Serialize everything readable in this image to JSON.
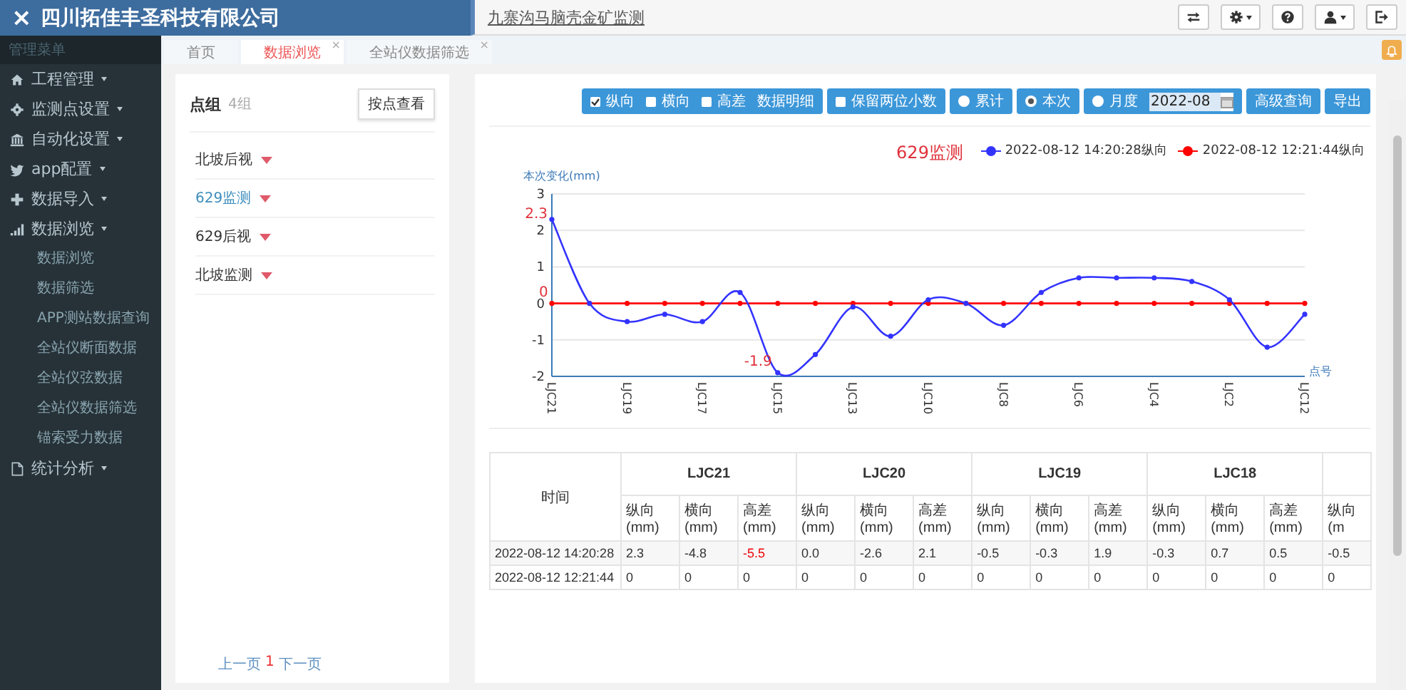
{
  "brand": {
    "close": "×",
    "title": "四川拓佳丰圣科技有限公司"
  },
  "header": {
    "title": "九寨沟马脑壳金矿监测"
  },
  "sidebar": {
    "heading": "管理菜单",
    "items": [
      {
        "label": "工程管理"
      },
      {
        "label": "监测点设置"
      },
      {
        "label": "自动化设置"
      },
      {
        "label": "app配置"
      },
      {
        "label": "数据导入"
      },
      {
        "label": "数据浏览",
        "children": [
          {
            "label": "数据浏览"
          },
          {
            "label": "数据筛选"
          },
          {
            "label": "APP测站数据查询"
          },
          {
            "label": "全站仪断面数据"
          },
          {
            "label": "全站仪弦数据"
          },
          {
            "label": "全站仪数据筛选"
          },
          {
            "label": "锚索受力数据"
          }
        ]
      },
      {
        "label": "统计分析"
      }
    ]
  },
  "tabs": [
    {
      "label": "首页",
      "selected": false
    },
    {
      "label": "数据浏览",
      "close": "×",
      "selected": true
    },
    {
      "label": "全站仪数据筛选",
      "close": "×",
      "selected": false
    }
  ],
  "groups_panel": {
    "title": "点组",
    "count": "4组",
    "button": "按点查看",
    "groups": [
      {
        "label": "北坡后视",
        "selected": false
      },
      {
        "label": "629监测",
        "selected": true
      },
      {
        "label": "629后视",
        "selected": false
      },
      {
        "label": "北坡监测",
        "selected": false
      }
    ],
    "pagination": [
      {
        "label": "上一页",
        "current": false
      },
      {
        "label": "1",
        "current": true
      },
      {
        "label": "下一页",
        "current": false
      }
    ]
  },
  "toolbar": [
    {
      "kind": "group",
      "items": [
        {
          "kind": "checkbox",
          "label": "纵向",
          "checked": true
        },
        {
          "kind": "checkbox",
          "label": "横向",
          "checked": false
        },
        {
          "kind": "checkbox",
          "label": "高差",
          "checked": false
        },
        {
          "kind": "text",
          "label": "数据明细"
        }
      ]
    },
    {
      "kind": "group",
      "items": [
        {
          "kind": "checkbox",
          "label": "保留两位小数",
          "checked": false
        }
      ]
    },
    {
      "kind": "group",
      "items": [
        {
          "kind": "radio",
          "label": "累计",
          "selected": false
        }
      ]
    },
    {
      "kind": "group",
      "items": [
        {
          "kind": "radio",
          "label": "本次",
          "selected": true
        }
      ]
    },
    {
      "kind": "group",
      "items": [
        {
          "kind": "radio",
          "label": "月度",
          "selected": false
        },
        {
          "kind": "date",
          "value": "2022-08"
        }
      ]
    },
    {
      "kind": "button",
      "label": "高级查询"
    },
    {
      "kind": "button",
      "label": "导出"
    }
  ],
  "chart": {
    "chart_data": {
      "type": "line",
      "title": "629监测",
      "xlabel": "点号",
      "ylabel": "本次变化(mm)",
      "categories": [
        "LJC21",
        null,
        "LJC19",
        null,
        "LJC17",
        null,
        "LJC15",
        null,
        "LJC13",
        null,
        "LJC10",
        null,
        "LJC8",
        null,
        "LJC6",
        null,
        "LJC4",
        null,
        "LJC2",
        null,
        "LJC12"
      ],
      "ylim": [
        -2,
        3
      ],
      "yticks": [
        -2,
        -1,
        0,
        1,
        2,
        3
      ],
      "grid": true,
      "legend": true,
      "series": [
        {
          "name": "2022-08-12 14:20:28纵向",
          "color": "#3333ff",
          "marker": "circle",
          "values": [
            2.3,
            0.0,
            -0.5,
            -0.3,
            -0.5,
            0.3,
            -1.9,
            -1.4,
            -0.1,
            -0.9,
            0.1,
            0.0,
            -0.6,
            0.3,
            0.7,
            0.7,
            0.7,
            0.6,
            0.1,
            -1.2,
            -0.3
          ]
        },
        {
          "name": "2022-08-12 12:21:44纵向",
          "color": "#ff0000",
          "marker": "circle",
          "values": [
            0,
            0,
            0,
            0,
            0,
            0,
            0,
            0,
            0,
            0,
            0,
            0,
            0,
            0,
            0,
            0,
            0,
            0,
            0,
            0,
            0
          ]
        }
      ],
      "annotations": [
        {
          "x": "LJC21",
          "y": 2.3,
          "text": "2.3"
        },
        {
          "x": "LJC15",
          "y": -1.9,
          "text": "-1.9"
        },
        {
          "x": "LJC21",
          "y": 0,
          "text": "0"
        }
      ]
    }
  },
  "table": {
    "header_rows": [
      [
        {
          "text": "时间",
          "rowspan": 2
        },
        {
          "text": "LJC21",
          "colspan": 3
        },
        {
          "text": "LJC20",
          "colspan": 3
        },
        {
          "text": "LJC19",
          "colspan": 3
        },
        {
          "text": "LJC18",
          "colspan": 3
        }
      ],
      [
        {
          "text": "纵向(mm)"
        },
        {
          "text": "横向(mm)"
        },
        {
          "text": "高差(mm)"
        },
        {
          "text": "纵向(mm)"
        },
        {
          "text": "横向(mm)"
        },
        {
          "text": "高差(mm)"
        },
        {
          "text": "纵向(mm)"
        },
        {
          "text": "横向(mm)"
        },
        {
          "text": "高差(mm)"
        },
        {
          "text": "纵向(mm)"
        },
        {
          "text": "横向(mm)"
        },
        {
          "text": "高差(mm)"
        },
        {
          "text": "纵向(m"
        }
      ]
    ],
    "rows": [
      {
        "time": "2022-08-12 14:20:28",
        "cells": [
          {
            "text": "2.3",
            "warn": false
          },
          {
            "text": "-4.8",
            "warn": false
          },
          {
            "text": "-5.5",
            "warn": true
          },
          {
            "text": "0.0",
            "warn": false
          },
          {
            "text": "-2.6",
            "warn": false
          },
          {
            "text": "2.1",
            "warn": false
          },
          {
            "text": "-0.5",
            "warn": false
          },
          {
            "text": "-0.3",
            "warn": false
          },
          {
            "text": "1.9",
            "warn": false
          },
          {
            "text": "-0.3",
            "warn": false
          },
          {
            "text": "0.7",
            "warn": false
          },
          {
            "text": "0.5",
            "warn": false
          },
          {
            "text": "-0.5",
            "warn": false
          }
        ]
      },
      {
        "time": "2022-08-12 12:21:44",
        "cells": [
          {
            "text": "0",
            "warn": false
          },
          {
            "text": "0",
            "warn": false
          },
          {
            "text": "0",
            "warn": false
          },
          {
            "text": "0",
            "warn": false
          },
          {
            "text": "0",
            "warn": false
          },
          {
            "text": "0",
            "warn": false
          },
          {
            "text": "0",
            "warn": false
          },
          {
            "text": "0",
            "warn": false
          },
          {
            "text": "0",
            "warn": false
          },
          {
            "text": "0",
            "warn": false
          },
          {
            "text": "0",
            "warn": false
          },
          {
            "text": "0",
            "warn": false
          },
          {
            "text": "0",
            "warn": false
          }
        ]
      }
    ]
  }
}
